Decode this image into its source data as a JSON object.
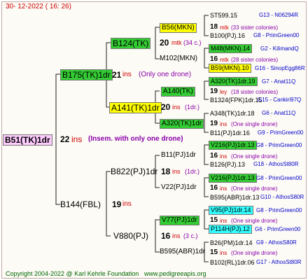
{
  "header": {
    "date": "30- 12-2022 ( 16: 26)"
  },
  "footer": {
    "copyright": "Copyright 2004-2022 @ Karl Kehrle Foundation",
    "site": "www.pedigreeapis.org"
  },
  "root": {
    "name": "B51(TK)1dr",
    "count": "22",
    "unit": "ins",
    "note": "(Insem. with only one drone)"
  },
  "sire_line": {
    "name": "B175(TK)1dr",
    "count": "21",
    "unit": "ins",
    "note": "(Only one drone)",
    "sire": {
      "name": "B124(TK)",
      "count": "20",
      "unit": "mtk",
      "note": "(34 c.)",
      "sire": {
        "name": "B56(MKN)",
        "count": "18",
        "unit": "mtk",
        "note": "(33 sister colonies)",
        "parents": [
          {
            "name": "ST599.15",
            "tag": "G13 - N06294R"
          },
          {
            "name": "B100(PJ).16",
            "tag": "G8 - PrimGreen00"
          }
        ]
      },
      "dam": {
        "name": "M102(MKN)",
        "count": "16",
        "unit": "mtk",
        "note": "(28 sister colonies)",
        "parents": [
          {
            "name": "M48(MKN).14",
            "tag": "G2 - KilimandQ"
          },
          {
            "name": "B59(MKN).10",
            "tag": "G16 - SinopEgg86R"
          }
        ]
      }
    },
    "dam": {
      "name": "A141(TK)1dr",
      "count": "20",
      "unit": "ins",
      "note": "(1dr.)",
      "sire": {
        "name": "A140(TK)",
        "count": "19",
        "unit": "ley",
        "note": "(18 sister colonies)",
        "parents": [
          {
            "name": "A320(TK)1dr.19",
            "tag": "G7 - Anat11Q"
          },
          {
            "name": "B1324(FPK)1dr.15",
            "tag": "G15 - Cankiri97Q"
          }
        ]
      },
      "dam": {
        "name": "A320(TK)1dr",
        "count": "19",
        "unit": "ins",
        "note": "(One single drone)",
        "parents": [
          {
            "name": "A348(TK)1dr.18",
            "tag": "G6 - Anat11Q"
          },
          {
            "name": "B11(PJ)1dr.16",
            "tag": "G9 - PrimGreen00"
          }
        ]
      }
    }
  },
  "dam_line": {
    "name": "B144(FBL)",
    "count": "19",
    "unit": "ins",
    "sire": {
      "name": "B822(PJ)1dr",
      "count": "18",
      "unit": "ins",
      "note": "(1dr.)",
      "sire": {
        "name": "B11(PJ)1dr",
        "count": "16",
        "unit": "ins",
        "note": "(One single drone)",
        "parents": [
          {
            "name": "V216(PJ)1dr.13",
            "tag": "G8 - PrimGreen00"
          },
          {
            "name": "B126(PJ).13",
            "tag": "G18 - AthosSt80R"
          }
        ]
      },
      "dam": {
        "name": "V22(PJ)1dr",
        "count": "16",
        "unit": "ins",
        "note": "(One single drone)",
        "parents": [
          {
            "name": "V216(PJ)1dr.13",
            "tag": "G8 - PrimGreen00"
          },
          {
            "name": "B595(ABR)1dr.13",
            "tag": "G10 - AthosS80R"
          }
        ]
      }
    },
    "dam": {
      "name": "V880(PJ)",
      "count": "16",
      "unit": "ins",
      "note": "(3 c.)",
      "sire": {
        "name": "V77(PJ)1dr",
        "count": "15",
        "unit": "ins",
        "note": "(One single drone)",
        "parents": [
          {
            "name": "V95(PJ)1dr.14",
            "tag": "G8 - PrimGreen00"
          },
          {
            "name": "P114H(PJ).12",
            "tag": "G6 - PrimGreen00"
          }
        ]
      },
      "dam": {
        "name": "B595(ABR)1dr",
        "count": "15",
        "unit": "ins",
        "note": "(One single drone)",
        "parents": [
          {
            "name": "B26(PM)1dr.14",
            "tag": "G9 - AthosS80R"
          },
          {
            "name": "B102(RL)1dr.06",
            "tag": "G17 - AthosSt80R"
          }
        ]
      }
    }
  },
  "colors": {
    "frame": "#c4a8a8",
    "green_hl": "#33cc33",
    "yellow_hl": "#ffff00",
    "cyan_hl": "#33ffff",
    "root_hl": "#ffccff",
    "count_red": "#cc0000",
    "tag_blue": "#0000cc"
  }
}
